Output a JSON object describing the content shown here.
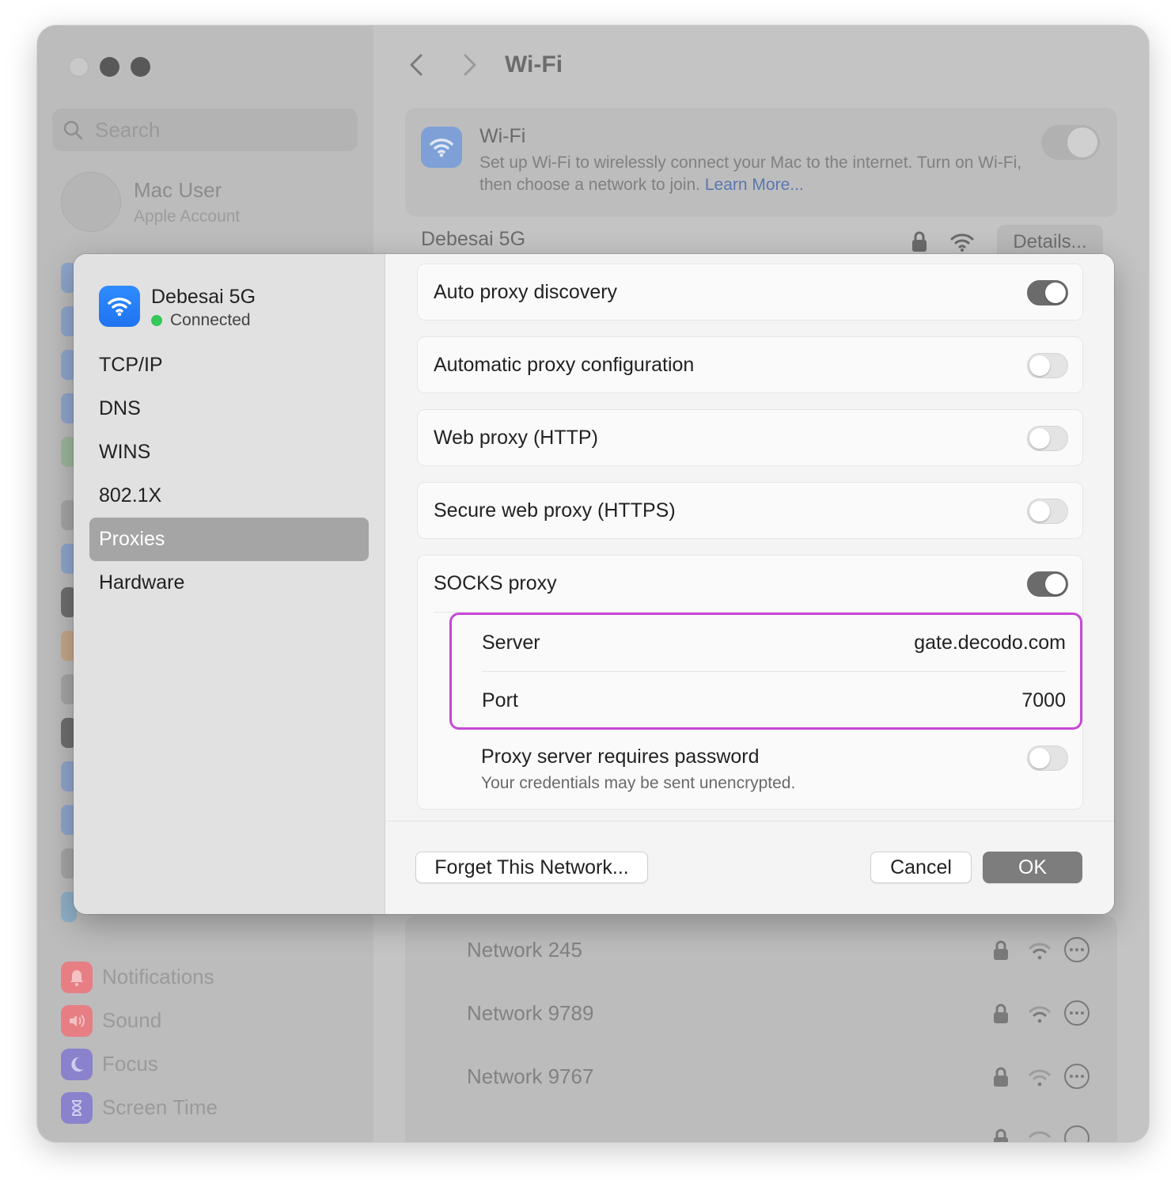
{
  "window": {
    "search_placeholder": "Search",
    "user": {
      "name": "Mac User",
      "subtitle": "Apple Account"
    },
    "sidebar_items": [
      {
        "label": "Notifications",
        "icon": "bell-icon",
        "color": "#e77e84"
      },
      {
        "label": "Sound",
        "icon": "speaker-icon",
        "color": "#e77e84"
      },
      {
        "label": "Focus",
        "icon": "moon-icon",
        "color": "#8a82cc"
      },
      {
        "label": "Screen Time",
        "icon": "hourglass-icon",
        "color": "#8a82cc"
      }
    ],
    "page_title": "Wi-Fi",
    "wifi_card": {
      "title": "Wi-Fi",
      "description": "Set up Wi-Fi to wirelessly connect your Mac to the internet. Turn on Wi-Fi, then choose a network to join.",
      "learn_more": "Learn More..."
    },
    "current_network": {
      "name": "Debesai 5G",
      "details_label": "Details..."
    },
    "other_networks": [
      {
        "name": "Network 245"
      },
      {
        "name": "Network 9789"
      },
      {
        "name": "Network 9767"
      }
    ]
  },
  "sheet": {
    "network_name": "Debesai 5G",
    "network_status": "Connected",
    "tabs": [
      "TCP/IP",
      "DNS",
      "WINS",
      "802.1X",
      "Proxies",
      "Hardware"
    ],
    "active_tab": "Proxies",
    "proxies": [
      {
        "label": "Auto proxy discovery",
        "on": true
      },
      {
        "label": "Automatic proxy configuration",
        "on": false
      },
      {
        "label": "Web proxy (HTTP)",
        "on": false
      },
      {
        "label": "Secure web proxy (HTTPS)",
        "on": false
      },
      {
        "label": "SOCKS proxy",
        "on": true
      }
    ],
    "socks": {
      "server_label": "Server",
      "server_value": "gate.decodo.com",
      "port_label": "Port",
      "port_value": "7000",
      "password_label": "Proxy server requires password",
      "password_note": "Your credentials may be sent unencrypted.",
      "password_on": false
    },
    "buttons": {
      "forget": "Forget This Network...",
      "cancel": "Cancel",
      "ok": "OK"
    },
    "highlight_color": "#c748d6",
    "status_color": "#34c759"
  }
}
